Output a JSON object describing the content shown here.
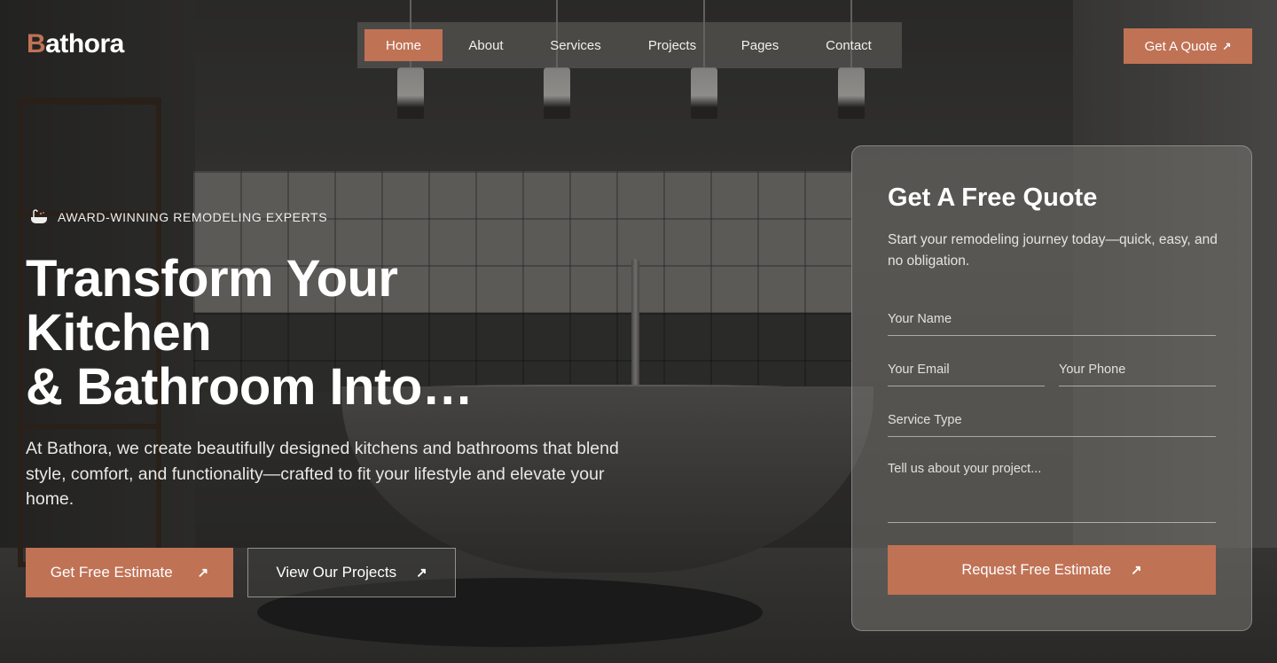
{
  "brand": {
    "initial": "B",
    "rest": "athora",
    "accent_color": "#c07255"
  },
  "nav": {
    "items": [
      {
        "label": "Home",
        "active": true
      },
      {
        "label": "About",
        "active": false
      },
      {
        "label": "Services",
        "active": false
      },
      {
        "label": "Projects",
        "active": false
      },
      {
        "label": "Pages",
        "active": false
      },
      {
        "label": "Contact",
        "active": false
      }
    ],
    "cta_label": "Get A Quote",
    "cta_icon": "arrow-up-right-icon"
  },
  "hero": {
    "badge_icon": "bathtub-icon",
    "badge_text": "AWARD-WINNING REMODELING EXPERTS",
    "title_lines": [
      "Transform Your",
      "Kitchen",
      "& Bathroom Into…"
    ],
    "description": "At Bathora, we create beautifully designed kitchens and bathrooms that blend style, comfort, and functionality—crafted to fit your lifestyle and elevate your home.",
    "primary_button": "Get Free Estimate",
    "secondary_button": "View Our Projects"
  },
  "quote_form": {
    "title": "Get A Free Quote",
    "subtitle": "Start your remodeling journey today—quick, easy, and no obligation.",
    "name_placeholder": "Your Name",
    "email_placeholder": "Your Email",
    "phone_placeholder": "Your Phone",
    "service_placeholder": "Service Type",
    "message_placeholder": "Tell us about your project...",
    "submit_label": "Request Free Estimate"
  }
}
